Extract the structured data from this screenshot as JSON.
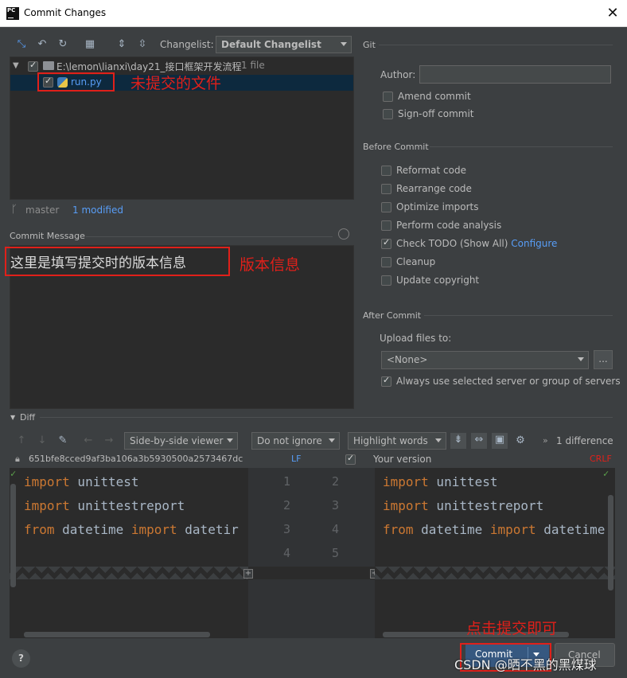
{
  "window": {
    "title": "Commit Changes",
    "logo": "PC"
  },
  "toolbar": {
    "changelist_label": "Changelist:",
    "changelist_value": "Default Changelist"
  },
  "tree": {
    "root_path": "E:\\lemon\\lianxi\\day21_接口框架开发流程",
    "root_count": "1 file",
    "file_name": "run.py"
  },
  "status": {
    "branch": "master",
    "modified": "1 modified"
  },
  "commit_message": {
    "label": "Commit Message",
    "text": "这里是填写提交时的版本信息"
  },
  "annotations": {
    "uncommitted_files": "未提交的文件",
    "version_info": "版本信息",
    "click_commit": "点击提交即可"
  },
  "git": {
    "section": "Git",
    "author_label": "Author:",
    "author_value": "",
    "amend_commit": "Amend commit",
    "signoff_commit": "Sign-off commit"
  },
  "before_commit": {
    "section": "Before Commit",
    "options": [
      {
        "label": "Reformat code",
        "checked": false
      },
      {
        "label": "Rearrange code",
        "checked": false
      },
      {
        "label": "Optimize imports",
        "checked": false
      },
      {
        "label": "Perform code analysis",
        "checked": false
      },
      {
        "label": "Check TODO (Show All)",
        "checked": true
      },
      {
        "label": "Cleanup",
        "checked": false
      },
      {
        "label": "Update copyright",
        "checked": false
      }
    ],
    "configure_link": "Configure"
  },
  "after_commit": {
    "section": "After Commit",
    "upload_label": "Upload files to:",
    "upload_value": "<None>",
    "browse": "...",
    "always_use": "Always use selected server or group of servers"
  },
  "diff": {
    "section": "Diff",
    "viewer": "Side-by-side viewer",
    "whitespace": "Do not ignore",
    "highlight": "Highlight words",
    "difference_count": "1 difference",
    "left_hash": "651bfe8cced9af3ba106a3b5930500a2573467dc",
    "left_sep": "LF",
    "right_title": "Your version",
    "right_sep": "CRLF",
    "left_lines": [
      {
        "kw": "import",
        "rest": " unittest"
      },
      {
        "kw": "import",
        "rest": " unittestreport"
      },
      {
        "kw": "from",
        "rest": " datetime ",
        "kw2": "import",
        "rest2": " datetir"
      }
    ],
    "right_lines": [
      {
        "kw": "import",
        "rest": " unittest"
      },
      {
        "kw": "import",
        "rest": " unittestreport"
      },
      {
        "kw": "from",
        "rest": " datetime ",
        "kw2": "import",
        "rest2": " datetime"
      }
    ],
    "left_nums": [
      "1",
      "2",
      "3",
      "4"
    ],
    "right_nums": [
      "2",
      "3",
      "4",
      "5"
    ]
  },
  "footer": {
    "help": "?",
    "commit": "Commit",
    "cancel": "Cancel",
    "watermark": "CSDN @晒不黑的黑煤球"
  },
  "colors": {
    "accent": "#589df6",
    "red_annotation": "#e0201a",
    "keyword": "#cc7832"
  }
}
